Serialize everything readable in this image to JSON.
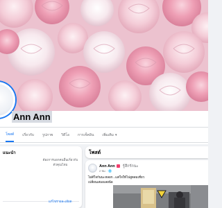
{
  "profile": {
    "name": "Ann Ann"
  },
  "tabs": [
    {
      "label": "โพสต์",
      "active": true
    },
    {
      "label": "เกี่ยวกับ",
      "active": false
    },
    {
      "label": "รูปภาพ",
      "active": false
    },
    {
      "label": "วิดีโอ",
      "active": false
    },
    {
      "label": "การเช็คอิน",
      "active": false
    },
    {
      "label": "เพิ่มเติม",
      "active": false
    }
  ],
  "left_card": {
    "title": "แนะนำ",
    "intro_text": "ต้องการบอกคนอื่นเกี่ยวกับตัวคุณไหม",
    "edit_link": "แก้ไขรายละเอียด"
  },
  "posts": {
    "header": "โพสต์",
    "items": [
      {
        "author": "Ann Ann",
        "feeling": "รู้สึกรักนะ",
        "time": "2 ชม. · 🌐",
        "text": "ไม่ดีใจกันนะหลอก...แต่ใจให้ไปสูดลมเที่ยวเปลี่ยนเสมอเลยน๊อ"
      }
    ]
  },
  "colors": {
    "accent": "#1877f2",
    "background": "#f0f2f5",
    "card": "#ffffff",
    "cover_rose": "#f3d3dd"
  }
}
